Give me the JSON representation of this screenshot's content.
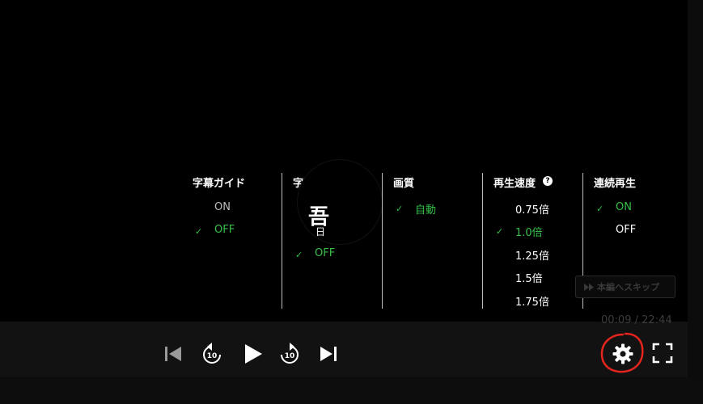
{
  "settings": {
    "subtitle_guide": {
      "title": "字幕ガイド",
      "options": [
        "ON",
        "OFF"
      ],
      "selected": "OFF"
    },
    "subtitles": {
      "title": "字幕",
      "partial_glyph": "吾",
      "partial_label": "日",
      "options": [
        "OFF"
      ],
      "selected": "OFF"
    },
    "quality": {
      "title": "画質",
      "options": [
        "自動"
      ],
      "selected": "自動"
    },
    "speed": {
      "title": "再生速度",
      "help": "?",
      "options": [
        "0.75倍",
        "1.0倍",
        "1.25倍",
        "1.5倍",
        "1.75倍"
      ],
      "selected": "1.0倍"
    },
    "autoplay": {
      "title": "連続再生",
      "options": [
        "ON",
        "OFF"
      ],
      "selected": "ON"
    },
    "check_mark": "✓"
  },
  "skip": {
    "icon": "fast-forward-icon",
    "label": "本編へスキップ"
  },
  "time": {
    "current": "00:09",
    "separator": " / ",
    "duration": "22:44"
  },
  "controls": {
    "prev_icon": "skip-previous-icon",
    "rewind_icon": "rewind-10-icon",
    "rewind_seconds": "10",
    "play_icon": "play-icon",
    "forward_icon": "forward-10-icon",
    "forward_seconds": "10",
    "next_icon": "skip-next-icon",
    "settings_icon": "gear-icon",
    "fullscreen_icon": "fullscreen-icon"
  },
  "colors": {
    "selected": "#35c04a",
    "inactive": "#bdbdbd",
    "annotation": "#e5251d"
  }
}
